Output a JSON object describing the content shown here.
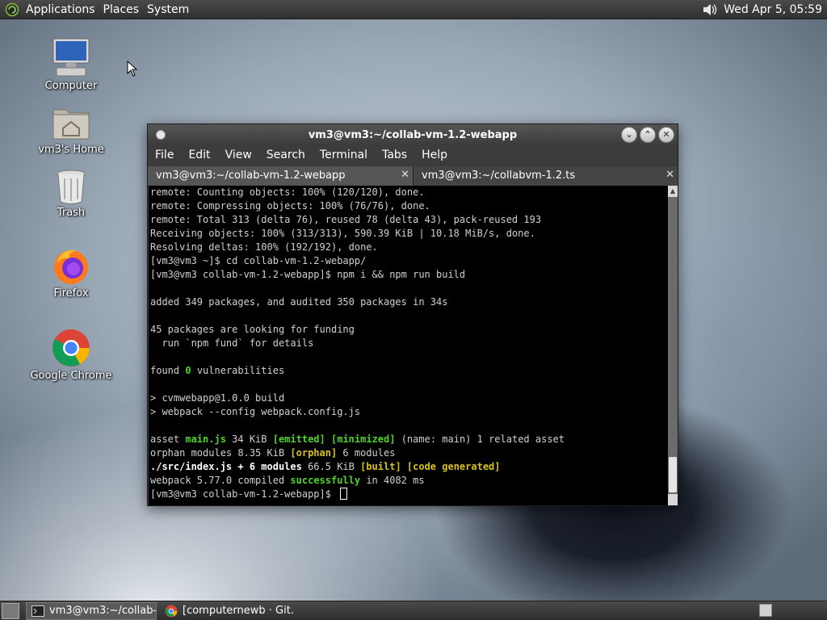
{
  "top_panel": {
    "menus": [
      "Applications",
      "Places",
      "System"
    ],
    "clock": "Wed Apr  5, 05:59"
  },
  "desktop_icons": [
    {
      "label": "Computer",
      "icon": "computer-icon"
    },
    {
      "label": "vm3's Home",
      "icon": "home-folder-icon"
    },
    {
      "label": "Trash",
      "icon": "trash-icon"
    },
    {
      "label": "Firefox",
      "icon": "firefox-icon"
    },
    {
      "label": "Google Chrome",
      "icon": "chrome-icon"
    }
  ],
  "terminal": {
    "title": "vm3@vm3:~/collab-vm-1.2-webapp",
    "menu": [
      "File",
      "Edit",
      "View",
      "Search",
      "Terminal",
      "Tabs",
      "Help"
    ],
    "tabs": [
      {
        "label": "vm3@vm3:~/collab-vm-1.2-webapp",
        "active": true
      },
      {
        "label": "vm3@vm3:~/collabvm-1.2.ts",
        "active": false
      }
    ],
    "lines": [
      "remote: Counting objects: 100% (120/120), done.",
      "remote: Compressing objects: 100% (76/76), done.",
      "remote: Total 313 (delta 76), reused 78 (delta 43), pack-reused 193",
      "Receiving objects: 100% (313/313), 590.39 KiB | 10.18 MiB/s, done.",
      "Resolving deltas: 100% (192/192), done.",
      "[vm3@vm3 ~]$ cd collab-vm-1.2-webapp/",
      "[vm3@vm3 collab-vm-1.2-webapp]$ npm i && npm run build",
      "",
      "added 349 packages, and audited 350 packages in 34s",
      "",
      "45 packages are looking for funding",
      "  run `npm fund` for details",
      "",
      "found 0 vulnerabilities",
      "",
      "> cvmwebapp@1.0.0 build",
      "> webpack --config webpack.config.js",
      "",
      "asset main.js 34 KiB [emitted] [minimized] (name: main) 1 related asset",
      "orphan modules 8.35 KiB [orphan] 6 modules",
      "./src/index.js + 6 modules 66.5 KiB [built] [code generated]",
      "webpack 5.77.0 compiled successfully in 4082 ms",
      "[vm3@vm3 collab-vm-1.2-webapp]$ "
    ]
  },
  "taskbar": {
    "tasks": [
      {
        "label": "vm3@vm3:~/collab-...",
        "icon": "terminal-icon",
        "active": true
      },
      {
        "label": "[computernewb · Git...",
        "icon": "chrome-icon",
        "active": false
      }
    ]
  },
  "colors": {
    "terminal_bg": "#000000",
    "terminal_fg": "#d0d0d0",
    "ansi_green": "#4fd32a",
    "ansi_yellow": "#d8c21a",
    "panel": "#3c3c3c"
  }
}
